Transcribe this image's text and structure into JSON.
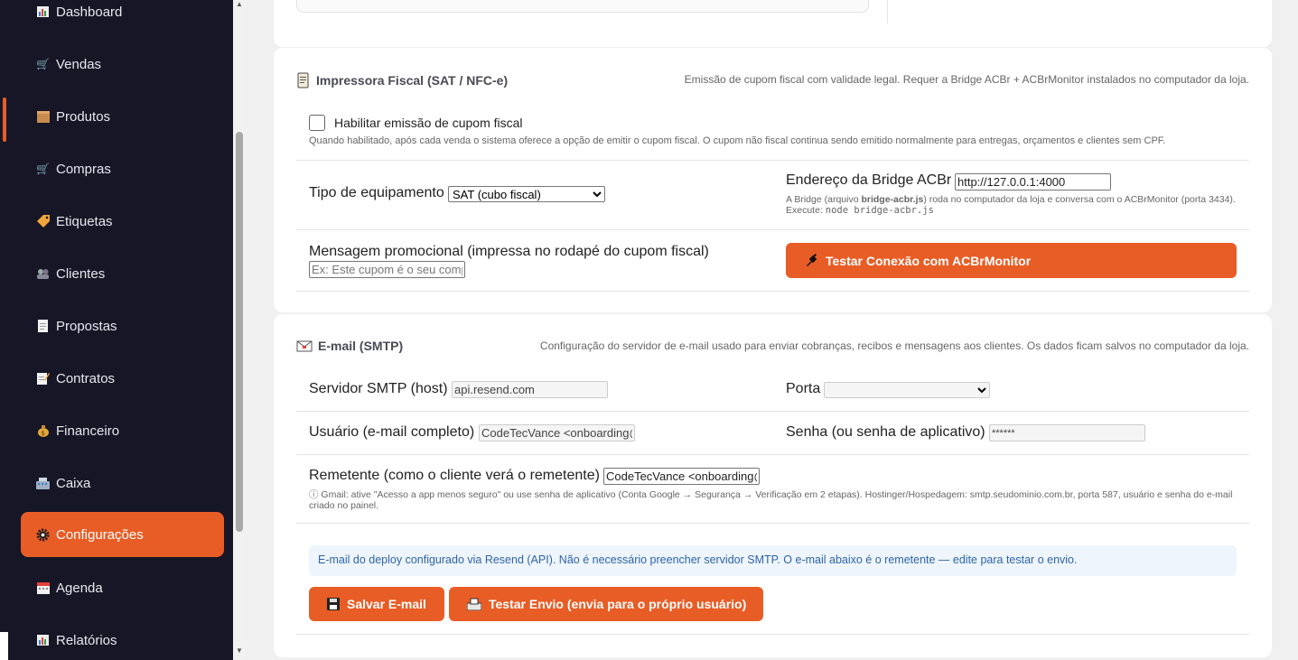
{
  "sidebar": {
    "items": [
      {
        "label": "Dashboard",
        "icon": "bar-chart-icon"
      },
      {
        "label": "Vendas",
        "icon": "cart-icon"
      },
      {
        "label": "Produtos",
        "icon": "box-icon"
      },
      {
        "label": "Compras",
        "icon": "cart-icon"
      },
      {
        "label": "Etiquetas",
        "icon": "tag-icon"
      },
      {
        "label": "Clientes",
        "icon": "users-icon"
      },
      {
        "label": "Propostas",
        "icon": "document-icon"
      },
      {
        "label": "Contratos",
        "icon": "memo-icon"
      },
      {
        "label": "Financeiro",
        "icon": "money-bag-icon"
      },
      {
        "label": "Caixa",
        "icon": "cash-register-icon"
      },
      {
        "label": "Configurações",
        "icon": "gear-icon",
        "active": true
      },
      {
        "label": "Agenda",
        "icon": "calendar-icon"
      },
      {
        "label": "Relatórios",
        "icon": "bar-chart-icon"
      }
    ],
    "accent_color": "#e85d26",
    "background": "#161626"
  },
  "fiscal": {
    "title": "Impressora Fiscal (SAT / NFC-e)",
    "description": "Emissão de cupom fiscal com validade legal. Requer a Bridge ACBr + ACBrMonitor instalados no computador da loja.",
    "enable_label": "Habilitar emissão de cupom fiscal",
    "enable_checked": false,
    "enable_hint": "Quando habilitado, após cada venda o sistema oferece a opção de emitir o cupom fiscal. O cupom não fiscal continua sendo emitido normalmente para entregas, orçamentos e clientes sem CPF.",
    "equipment_label": "Tipo de equipamento",
    "equipment_value": "SAT (cubo fiscal)",
    "bridge_label": "Endereço da Bridge ACBr",
    "bridge_value": "http://127.0.0.1:4000",
    "bridge_hint_pre": "A Bridge (arquivo ",
    "bridge_hint_file": "bridge-acbr.js",
    "bridge_hint_mid": ") roda no computador da loja e conversa com o ACBrMonitor (porta 3434). Execute: ",
    "bridge_hint_cmd": "node bridge-acbr.js",
    "promo_label": "Mensagem promocional (impressa no rodapé do cupom fiscal)",
    "promo_placeholder": "Ex: Este cupom é o seu comprovante",
    "test_button": "Testar Conexão com ACBrMonitor"
  },
  "smtp": {
    "title": "E-mail (SMTP)",
    "description": "Configuração do servidor de e-mail usado para enviar cobranças, recibos e mensagens aos clientes. Os dados ficam salvos no computador da loja.",
    "host_label": "Servidor SMTP (host)",
    "host_value": "api.resend.com",
    "port_label": "Porta",
    "port_value": "",
    "user_label": "Usuário (e-mail completo)",
    "user_value": "CodeTecVance <onboarding@resend.dev>",
    "password_label": "Senha (ou senha de aplicativo)",
    "password_value": "******",
    "sender_label": "Remetente (como o cliente verá o remetente)",
    "sender_value": "CodeTecVance <onboarding@resend.dev>",
    "info_hint": "ⓘ Gmail: ative \"Acesso a app menos seguro\" ou use senha de aplicativo (Conta Google → Segurança → Verificação em 2 etapas). Hostinger/Hospedagem: smtp.seudominio.com.br, porta 587, usuário e senha do e-mail criado no painel.",
    "resend_notice": "E-mail do deploy configurado via Resend (API). Não é necessário preencher servidor SMTP. O e-mail abaixo é o remetente — edite para testar o envio.",
    "save_button": "Salvar E-mail",
    "test_button": "Testar Envio (envia para o próprio usuário)"
  }
}
